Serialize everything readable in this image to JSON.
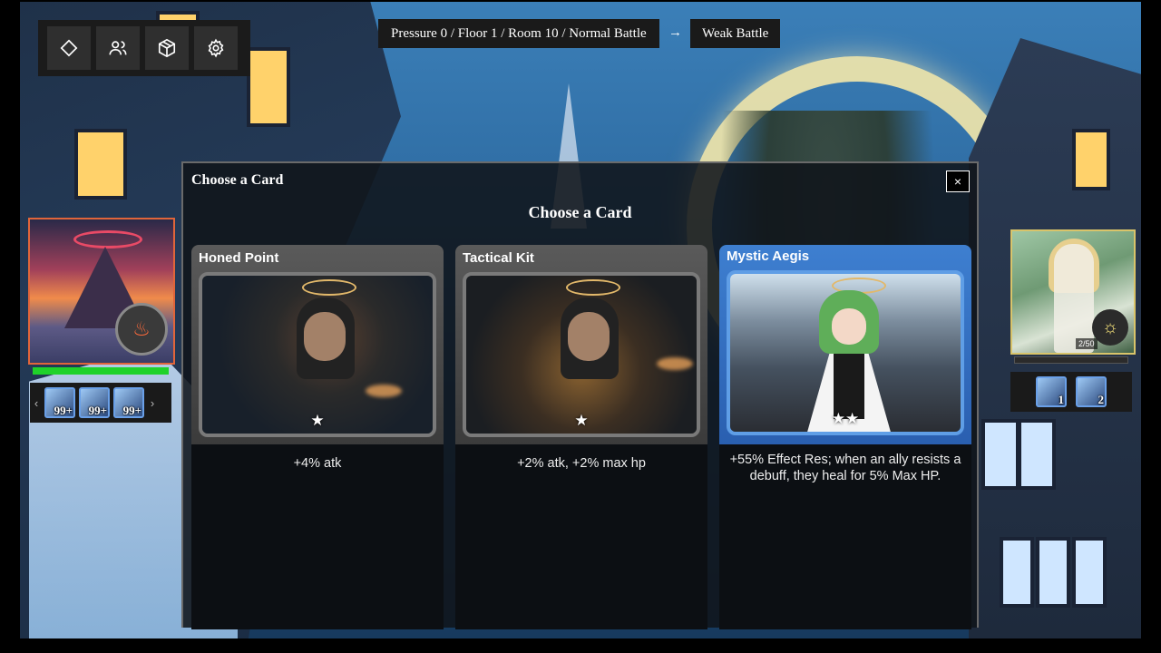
{
  "topbar": {
    "buttons": [
      {
        "icon": "diamond-icon"
      },
      {
        "icon": "users-icon"
      },
      {
        "icon": "cube-icon"
      },
      {
        "icon": "gear-icon"
      }
    ]
  },
  "breadcrumb": {
    "path": "Pressure 0 / Floor 1 / Room 10 / Normal Battle",
    "arrow": "→",
    "next": "Weak Battle"
  },
  "left_party": {
    "status_icon": "flame-icon",
    "hp_color": "#1fd22a",
    "prev_label": "‹",
    "next_label": "›",
    "buffs": [
      {
        "count": "99+"
      },
      {
        "count": "99+"
      },
      {
        "count": "99+"
      }
    ]
  },
  "right_party": {
    "status_icon": "sun-icon",
    "counter": "2/50",
    "buffs": [
      {
        "count": "1"
      },
      {
        "count": "2"
      }
    ]
  },
  "modal": {
    "title": "Choose a Card",
    "close_label": "×",
    "heading": "Choose a Card",
    "cards": [
      {
        "name": "Honed Point",
        "stars": "★",
        "description": "+4% atk",
        "rarity_color": "#5a5a5a"
      },
      {
        "name": "Tactical Kit",
        "stars": "★",
        "description": "+2% atk, +2% max hp",
        "rarity_color": "#5a5a5a"
      },
      {
        "name": "Mystic Aegis",
        "stars": "★★",
        "description": "+55% Effect Res; when an ally resists a debuff, they heal for 5% Max HP.",
        "rarity_color": "#3e7fd0"
      }
    ]
  }
}
